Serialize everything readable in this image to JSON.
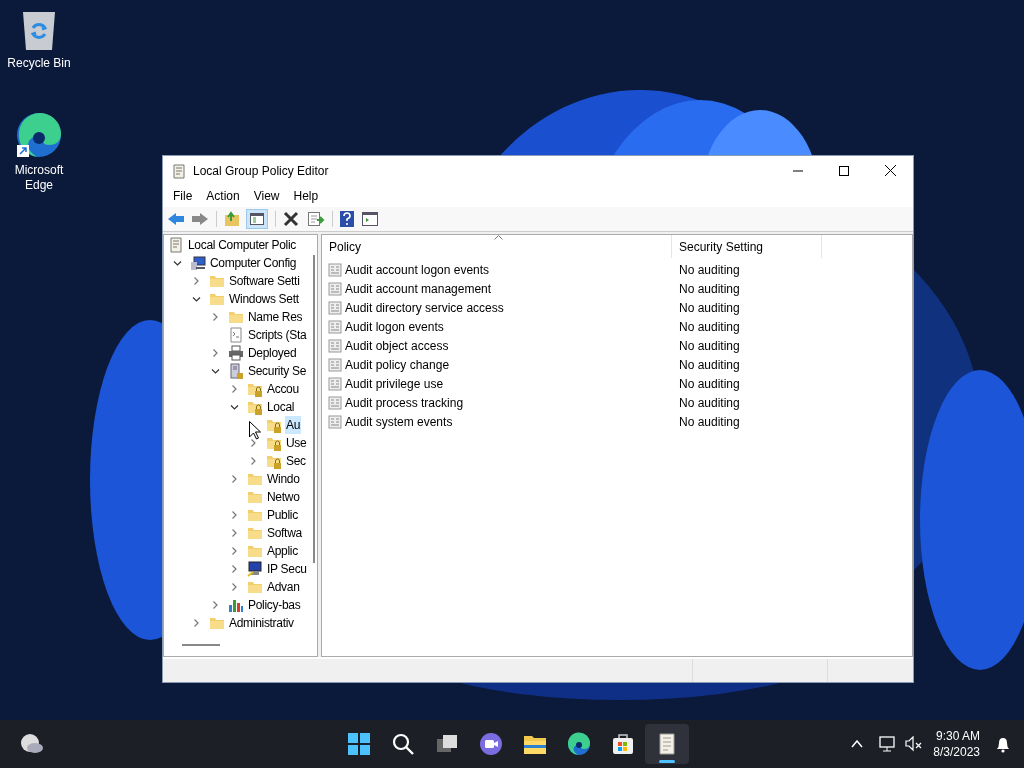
{
  "desktop_icons": [
    {
      "kind": "recycle",
      "label": "Recycle Bin"
    },
    {
      "kind": "edge",
      "label": "Microsoft Edge"
    }
  ],
  "window": {
    "title": "Local Group Policy Editor"
  },
  "menu": [
    "File",
    "Action",
    "View",
    "Help"
  ],
  "tree": [
    {
      "label": "Local Computer Polic",
      "kind": "doc",
      "selected": false,
      "children": [
        {
          "label": "Computer Config",
          "kind": "computer",
          "expanded": true,
          "selected": false,
          "children": [
            {
              "label": "Software Setti",
              "kind": "folder",
              "expanded": false,
              "selected": false
            },
            {
              "label": "Windows Sett",
              "kind": "folder",
              "expanded": true,
              "selected": false,
              "children": [
                {
                  "label": "Name Res",
                  "kind": "folder",
                  "expanded": false,
                  "selected": false
                },
                {
                  "label": "Scripts (Sta",
                  "kind": "scripts",
                  "selected": false
                },
                {
                  "label": "Deployed",
                  "kind": "printer",
                  "expanded": false,
                  "selected": false
                },
                {
                  "label": "Security Se",
                  "kind": "security",
                  "expanded": true,
                  "selected": false,
                  "children": [
                    {
                      "label": "Accou",
                      "kind": "lockfolder",
                      "expanded": false,
                      "selected": false
                    },
                    {
                      "label": "Local",
                      "kind": "lockfolder",
                      "expanded": true,
                      "selected": false,
                      "children": [
                        {
                          "label": "Au",
                          "kind": "lockfolder",
                          "selected": true
                        },
                        {
                          "label": "Use",
                          "kind": "lockfolder",
                          "expanded": false,
                          "selected": false
                        },
                        {
                          "label": "Sec",
                          "kind": "lockfolder",
                          "expanded": false,
                          "selected": false
                        }
                      ]
                    },
                    {
                      "label": "Windo",
                      "kind": "folder",
                      "expanded": false,
                      "selected": false
                    },
                    {
                      "label": "Netwo",
                      "kind": "folder",
                      "selected": false
                    },
                    {
                      "label": "Public",
                      "kind": "folder",
                      "expanded": false,
                      "selected": false
                    },
                    {
                      "label": "Softwa",
                      "kind": "folder",
                      "expanded": false,
                      "selected": false
                    },
                    {
                      "label": "Applic",
                      "kind": "folder",
                      "expanded": false,
                      "selected": false
                    },
                    {
                      "label": "IP Secu",
                      "kind": "ip",
                      "expanded": false,
                      "selected": false
                    },
                    {
                      "label": "Advan",
                      "kind": "folder",
                      "expanded": false,
                      "selected": false
                    }
                  ]
                },
                {
                  "label": "Policy-bas",
                  "kind": "chart",
                  "expanded": false,
                  "selected": false
                }
              ]
            },
            {
              "label": "Administrativ",
              "kind": "folder",
              "expanded": false,
              "selected": false
            }
          ]
        }
      ]
    }
  ],
  "table": {
    "columns": [
      "Policy",
      "Security Setting"
    ],
    "rows": [
      {
        "policy": "Audit account logon events",
        "setting": "No auditing"
      },
      {
        "policy": "Audit account management",
        "setting": "No auditing"
      },
      {
        "policy": "Audit directory service access",
        "setting": "No auditing"
      },
      {
        "policy": "Audit logon events",
        "setting": "No auditing"
      },
      {
        "policy": "Audit object access",
        "setting": "No auditing"
      },
      {
        "policy": "Audit policy change",
        "setting": "No auditing"
      },
      {
        "policy": "Audit privilege use",
        "setting": "No auditing"
      },
      {
        "policy": "Audit process tracking",
        "setting": "No auditing"
      },
      {
        "policy": "Audit system events",
        "setting": "No auditing"
      }
    ]
  },
  "taskbar": {
    "apps": [
      {
        "kind": "start",
        "active": false
      },
      {
        "kind": "search",
        "active": false
      },
      {
        "kind": "taskview",
        "active": false
      },
      {
        "kind": "chat",
        "active": false
      },
      {
        "kind": "explorer",
        "active": false
      },
      {
        "kind": "edge",
        "active": false
      },
      {
        "kind": "store",
        "active": false
      },
      {
        "kind": "gpedit",
        "active": true
      }
    ],
    "time": "9:30 AM",
    "date": "8/3/2023"
  }
}
